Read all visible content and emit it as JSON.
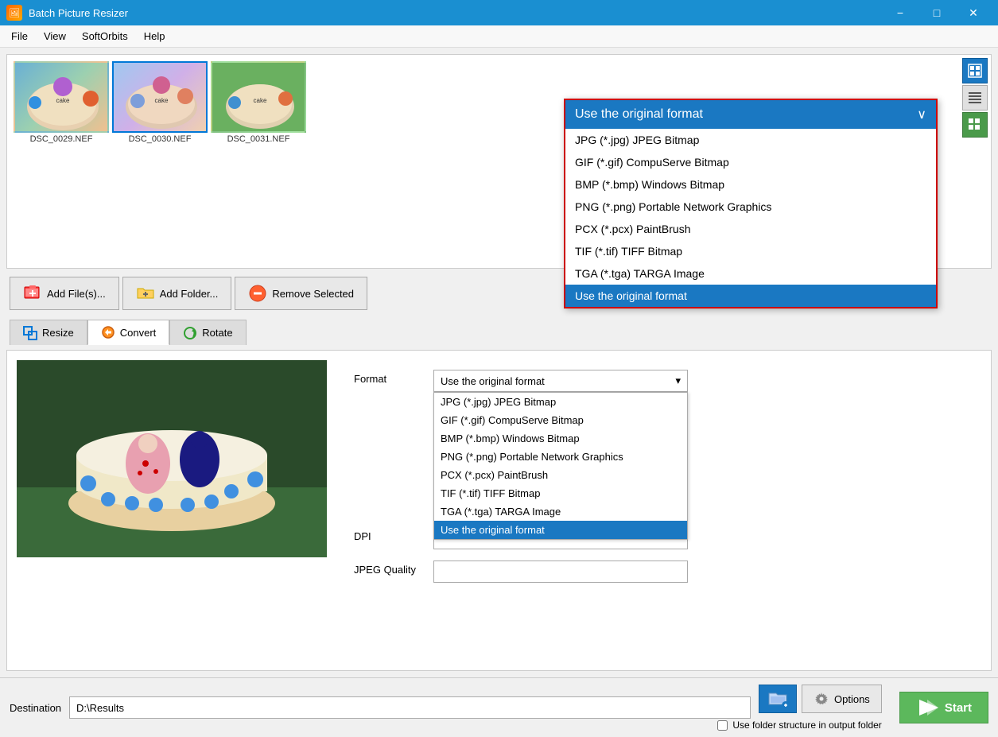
{
  "app": {
    "title": "Batch Picture Resizer",
    "icon": "🖼"
  },
  "titlebar": {
    "minimize": "−",
    "maximize": "□",
    "close": "✕"
  },
  "menu": {
    "items": [
      "File",
      "View",
      "SoftOrbits",
      "Help"
    ]
  },
  "images": [
    {
      "label": "DSC_0029.NEF",
      "selected": false
    },
    {
      "label": "DSC_0030.NEF",
      "selected": true
    },
    {
      "label": "DSC_0031.NEF",
      "selected": false
    }
  ],
  "toolbar": {
    "add_files": "Add File(s)...",
    "add_folder": "Add Folder...",
    "remove_selected": "Remove Selected"
  },
  "tabs": [
    {
      "label": "Resize"
    },
    {
      "label": "Convert"
    },
    {
      "label": "Rotate"
    }
  ],
  "format_overlay": {
    "selected_label": "Use the original format",
    "items": [
      "JPG (*.jpg) JPEG Bitmap",
      "GIF (*.gif) CompuServe Bitmap",
      "BMP (*.bmp) Windows Bitmap",
      "PNG (*.png) Portable Network Graphics",
      "PCX (*.pcx) PaintBrush",
      "TIF (*.tif) TIFF Bitmap",
      "TGA (*.tga) TARGA Image",
      "Use the original format"
    ],
    "highlighted": "Use the original format"
  },
  "convert_form": {
    "format_label": "Format",
    "dpi_label": "DPI",
    "jpeg_quality_label": "JPEG Quality",
    "format_selected": "Use the original format",
    "format_options": [
      "JPG (*.jpg) JPEG Bitmap",
      "GIF (*.gif) CompuServe Bitmap",
      "BMP (*.bmp) Windows Bitmap",
      "PNG (*.png) Portable Network Graphics",
      "PCX (*.pcx) PaintBrush",
      "TIF (*.tif) TIFF Bitmap",
      "TGA (*.tga) TARGA Image",
      "Use the original format"
    ],
    "highlighted": "Use the original format"
  },
  "destination": {
    "label": "Destination",
    "value": "D:\\Results",
    "checkbox_label": "Use folder structure in output folder"
  },
  "bottom": {
    "options_label": "Options",
    "start_label": "Start"
  }
}
